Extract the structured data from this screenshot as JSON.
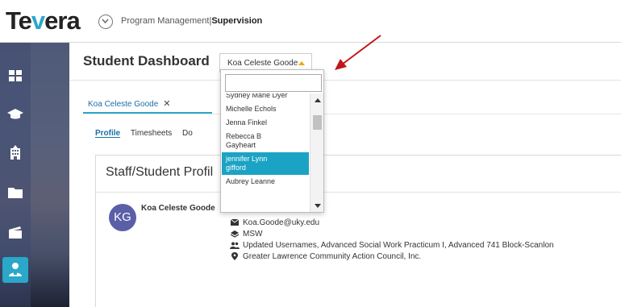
{
  "brand": {
    "logo_prefix": "Te",
    "logo_accent": "v",
    "logo_suffix": "era",
    "accent_color": "#2aa7c9"
  },
  "header": {
    "breadcrumb_section": "Program Management",
    "breadcrumb_separator": "|",
    "breadcrumb_current": "Supervision"
  },
  "sidebar": {
    "items": [
      {
        "icon": "dashboard-grid-icon"
      },
      {
        "icon": "graduation-cap-icon"
      },
      {
        "icon": "building-icon"
      },
      {
        "icon": "folder-icon"
      },
      {
        "icon": "clapperboard-icon"
      },
      {
        "icon": "user-badge-icon",
        "active": true
      }
    ]
  },
  "page": {
    "title": "Student Dashboard",
    "student_select_value": "Koa Celeste Goode"
  },
  "student_tab": {
    "label": "Koa Celeste Goode",
    "close": "✕"
  },
  "subtabs": [
    {
      "label": "Profile",
      "active": true
    },
    {
      "label": "Timesheets"
    },
    {
      "label": "Do"
    }
  ],
  "card": {
    "title": "Staff/Student Profil",
    "avatar_initials": "KG",
    "name": "Koa Celeste Goode",
    "email": "Koa.Goode@uky.edu",
    "degree": "MSW",
    "groups": "Updated Usernames, Advanced Social Work Practicum I, Advanced 741 Block-Scanlon",
    "agency": "Greater Lawrence Community Action Council, Inc."
  },
  "dropdown": {
    "search_value": "",
    "options": [
      {
        "label": "Sydney Marie Dyer"
      },
      {
        "label": "Michelle Echols"
      },
      {
        "label": "Jenna Finkel"
      },
      {
        "label": "Rebecca B Gayheart"
      },
      {
        "label": "jennifer Lynn gifford",
        "selected": true
      },
      {
        "label": "Aubrey Leanne"
      }
    ]
  },
  "annotation": {
    "arrow_color": "#c0161b"
  }
}
